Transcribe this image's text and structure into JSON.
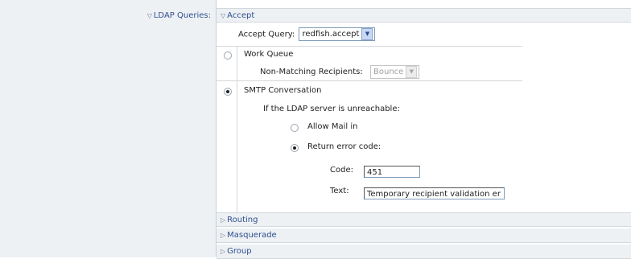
{
  "ldap_queries_label": "LDAP Queries:",
  "accept_section": {
    "header": "Accept",
    "accept_query_label": "Accept Query:",
    "accept_query_value": "redfish.accept",
    "work_queue": {
      "label": "Work Queue",
      "selected": false,
      "non_matching_label": "Non-Matching Recipients:",
      "non_matching_value": "Bounce"
    },
    "smtp_conversation": {
      "label": "SMTP Conversation",
      "selected": true,
      "unreachable_label": "If the LDAP server is unreachable:",
      "allow_mail_label": "Allow Mail in",
      "allow_mail_selected": false,
      "return_error_label": "Return error code:",
      "return_error_selected": true,
      "code_label": "Code:",
      "code_value": "451",
      "text_label": "Text:",
      "text_value": "Temporary recipient validation er"
    }
  },
  "sections": {
    "routing": "Routing",
    "masquerade": "Masquerade",
    "group": "Group"
  },
  "icons": {
    "expanded": "triangle-down-icon",
    "collapsed": "triangle-right-icon",
    "dropdown": "chevron-down-icon"
  },
  "colors": {
    "link_blue": "#2f4f8f",
    "panel_bg": "#eef1f4",
    "divider": "#d3d7dc"
  }
}
